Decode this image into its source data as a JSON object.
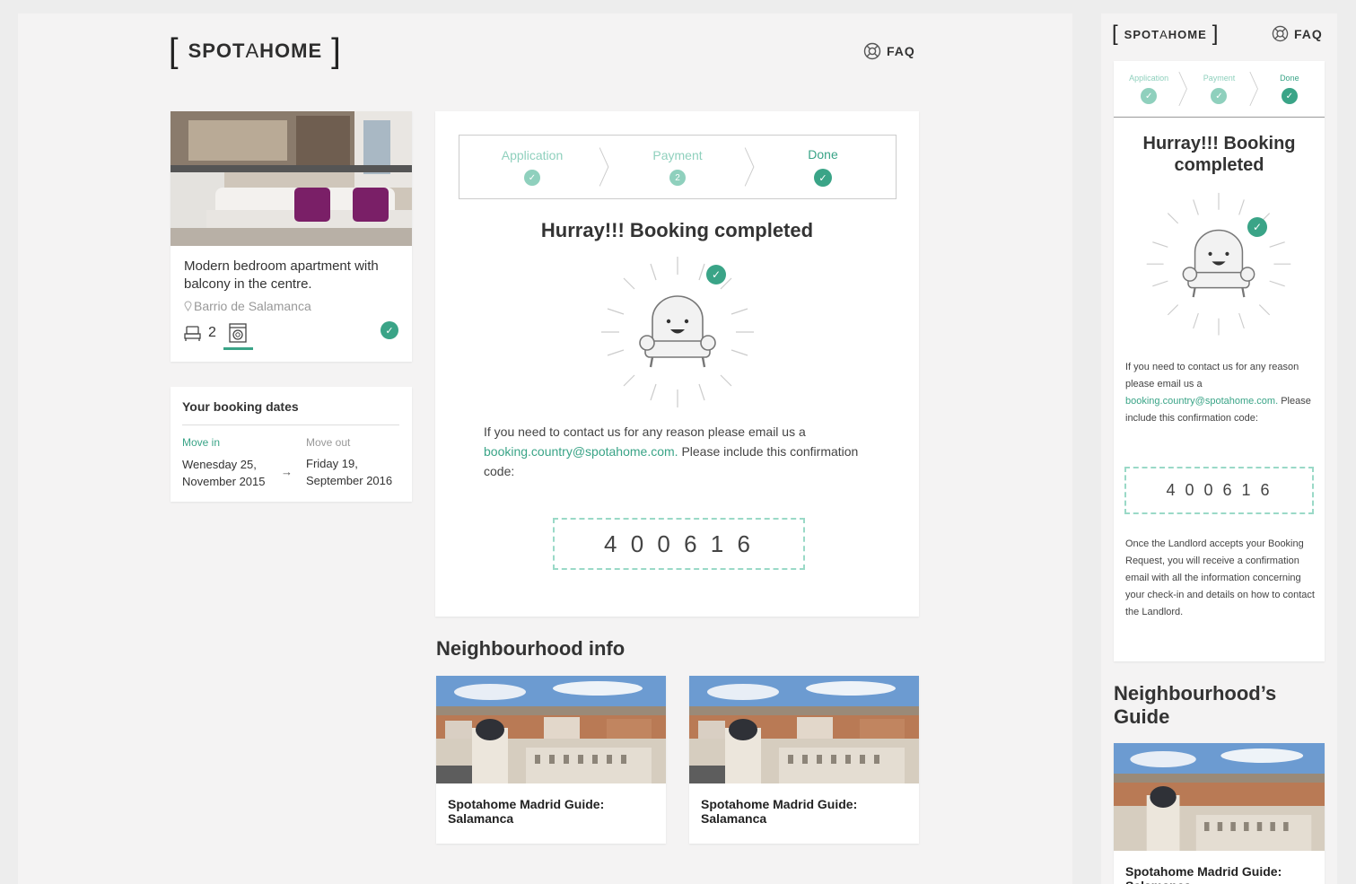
{
  "brand": {
    "left_bracket": "[",
    "name_a": "SPOT",
    "name_b": "A",
    "name_c": "HOME",
    "right_bracket": "]"
  },
  "faq_label": "FAQ",
  "listing": {
    "title": "Modern bedroom apartment with balcony in the centre.",
    "location": "Barrio de Salamanca",
    "bedrooms": "2"
  },
  "dates": {
    "heading": "Your booking dates",
    "move_in_label": "Move in",
    "move_in_value": "Wenesday 25, November 2015",
    "move_out_label": "Move out",
    "move_out_value": "Friday 19, September 2016",
    "arrow": "→"
  },
  "steps": [
    {
      "label": "Application",
      "badge": "✓"
    },
    {
      "label": "Payment",
      "badge": "2"
    },
    {
      "label": "Done",
      "badge": "✓"
    }
  ],
  "mobile_steps": [
    {
      "label": "Application",
      "badge": "✓"
    },
    {
      "label": "Payment",
      "badge": "✓"
    },
    {
      "label": "Done",
      "badge": "✓"
    }
  ],
  "confirmation": {
    "heading": "Hurray!!! Booking completed",
    "text_before": "If you need to contact us for any reason please email us a ",
    "email": "booking.country@spotahome.com.",
    "text_after": " Please include this confirmation code:",
    "code": "4 0 0 6 1 6"
  },
  "neighbourhood": {
    "heading": "Neighbourhood info",
    "guides": [
      {
        "title": "Spotahome Madrid Guide: Salamanca"
      },
      {
        "title": "Spotahome Madrid Guide: Salamanca"
      }
    ]
  },
  "mobile": {
    "heading": "Hurray!!! Booking completed",
    "text_before": "If you need to contact us for any reason please email us a ",
    "email": "booking.country@spotahome.com.",
    "text_after": " Please include this confirmation code:",
    "code": "4 0 0 6 1 6",
    "landlord_note": "Once the Landlord accepts your Booking Request, you will receive a confirmation email with all the information concerning your check-in and details on how to contact the Landlord.",
    "guide_heading": "Neighbourhood’s Guide",
    "guide_title": "Spotahome Madrid Guide: Salamanca"
  },
  "colors": {
    "accent": "#3aa487",
    "accent_light": "#8fd0bd",
    "background": "#f4f3f3"
  },
  "icons": [
    "lifebuoy-icon",
    "location-pin-icon",
    "bed-icon",
    "washing-machine-icon",
    "check-icon",
    "armchair-mascot-icon"
  ]
}
